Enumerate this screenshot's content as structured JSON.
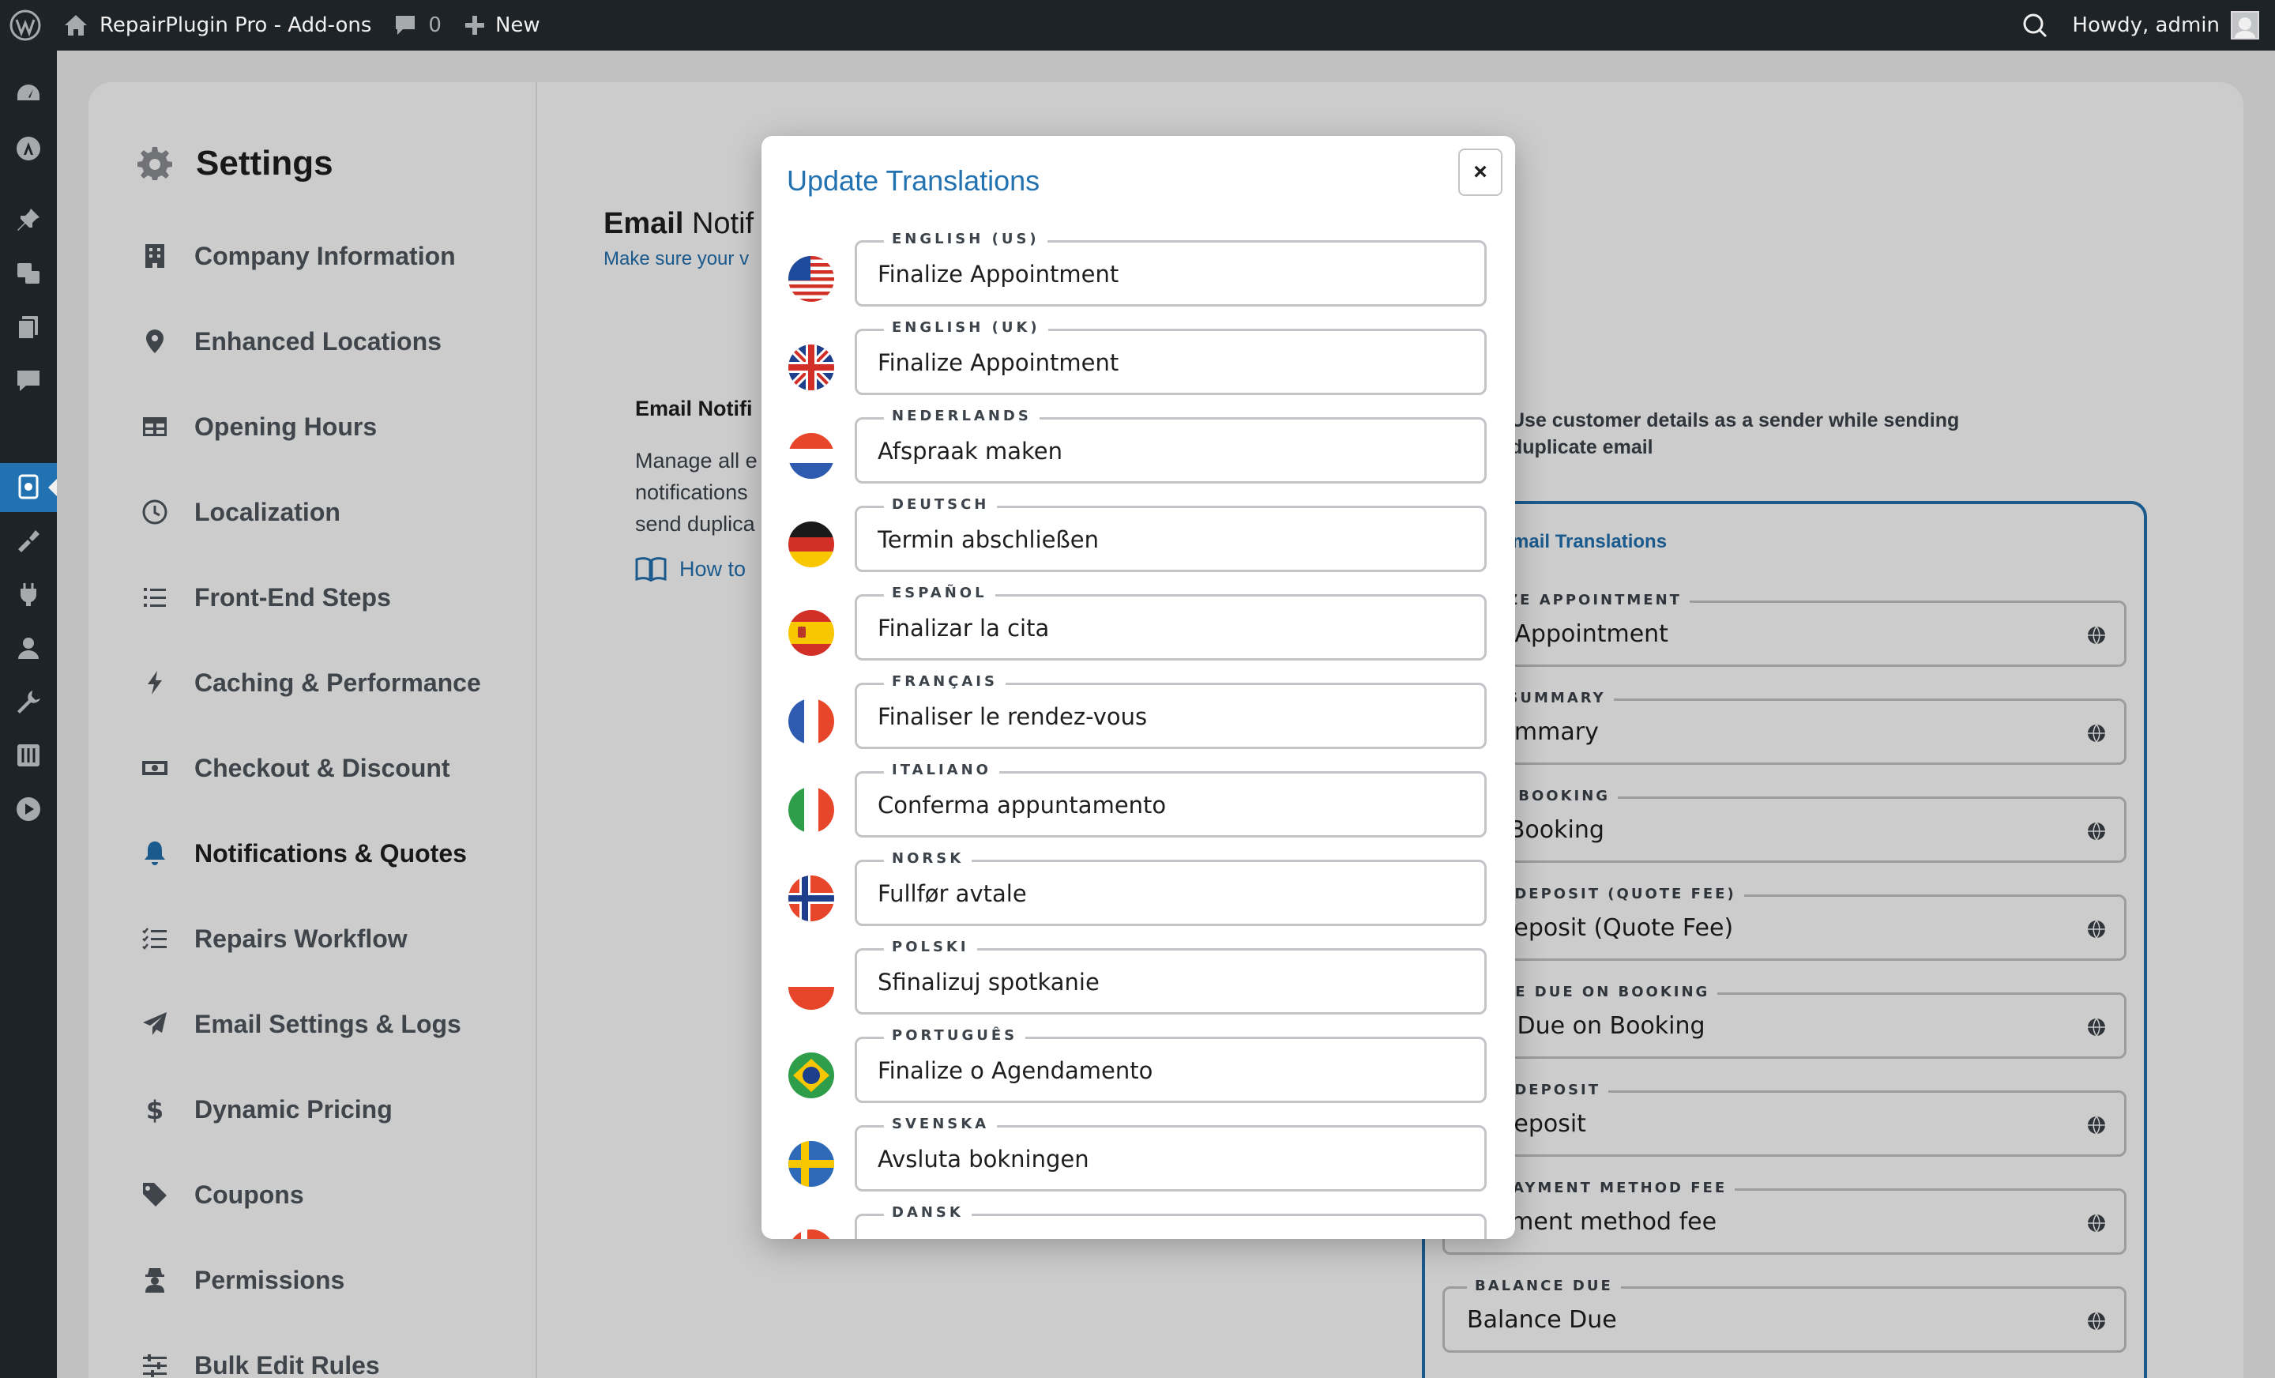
{
  "adminbar": {
    "site_name": "RepairPlugin Pro - Add-ons",
    "comments_count": "0",
    "new_label": "New",
    "howdy": "Howdy, admin"
  },
  "settings": {
    "title": "Settings",
    "nav": [
      {
        "label": "Company Information",
        "icon": "building-icon"
      },
      {
        "label": "Enhanced Locations",
        "icon": "location-pin-icon"
      },
      {
        "label": "Opening Hours",
        "icon": "table-icon"
      },
      {
        "label": "Localization",
        "icon": "clock-icon"
      },
      {
        "label": "Front-End Steps",
        "icon": "list-icon"
      },
      {
        "label": "Caching & Performance",
        "icon": "lightning-icon"
      },
      {
        "label": "Checkout & Discount",
        "icon": "money-icon"
      },
      {
        "label": "Notifications & Quotes",
        "icon": "bell-icon"
      },
      {
        "label": "Repairs Workflow",
        "icon": "checklist-icon"
      },
      {
        "label": "Email Settings & Logs",
        "icon": "paper-plane-icon"
      },
      {
        "label": "Dynamic Pricing",
        "icon": "dollar-icon"
      },
      {
        "label": "Coupons",
        "icon": "tag-icon"
      },
      {
        "label": "Permissions",
        "icon": "user-secret-icon"
      },
      {
        "label": "Bulk Edit Rules",
        "icon": "sliders-icon"
      }
    ]
  },
  "background": {
    "email_heading_bold": "Email",
    "email_heading_rest": "Notif",
    "email_subtext": "Make sure your v",
    "section_label": "Email Notifi",
    "section_desc_1": "Manage all e",
    "section_desc_2": "notifications",
    "section_desc_3": "send duplica",
    "how_to": "How to",
    "sender_option_1": "Use customer details as a sender while sending",
    "sender_option_2": "duplicate email",
    "translations_title": "mail Translations",
    "fields": [
      {
        "label": "ALIZE APPOINTMENT",
        "value": "lize Appointment"
      },
      {
        "label": "ER SUMMARY",
        "value": "r Summary"
      },
      {
        "label": "CEL BOOKING",
        "value": "cel Booking"
      },
      {
        "label": "IAL DEPOSIT (QUOTE FEE)",
        "value": "al Deposit (Quote Fee)"
      },
      {
        "label": "ANCE DUE ON BOOKING",
        "value": "nce Due on Booking"
      },
      {
        "label": "IAL DEPOSIT",
        "value": "al Deposit"
      },
      {
        "label": "L. PAYMENT METHOD FEE",
        "value": "payment method fee"
      },
      {
        "label": "BALANCE DUE",
        "value": "Balance Due"
      }
    ]
  },
  "modal": {
    "title": "Update Translations",
    "close_label": "×",
    "languages": [
      {
        "label": "ENGLISH (US)",
        "value": "Finalize Appointment",
        "flag": "us-flag-icon"
      },
      {
        "label": "ENGLISH (UK)",
        "value": "Finalize Appointment",
        "flag": "uk-flag-icon"
      },
      {
        "label": "NEDERLANDS",
        "value": "Afspraak maken",
        "flag": "nl-flag-icon"
      },
      {
        "label": "DEUTSCH",
        "value": "Termin abschließen",
        "flag": "de-flag-icon"
      },
      {
        "label": "ESPAÑOL",
        "value": "Finalizar la cita",
        "flag": "es-flag-icon"
      },
      {
        "label": "FRANÇAIS",
        "value": "Finaliser le rendez-vous",
        "flag": "fr-flag-icon"
      },
      {
        "label": "ITALIANO",
        "value": "Conferma appuntamento",
        "flag": "it-flag-icon"
      },
      {
        "label": "NORSK",
        "value": "Fullfør avtale",
        "flag": "no-flag-icon"
      },
      {
        "label": "POLSKI",
        "value": "Sfinalizuj spotkanie",
        "flag": "pl-flag-icon"
      },
      {
        "label": "PORTUGUÊS",
        "value": "Finalize o Agendamento",
        "flag": "br-flag-icon"
      },
      {
        "label": "SVENSKA",
        "value": "Avsluta bokningen",
        "flag": "se-flag-icon"
      },
      {
        "label": "DANSK",
        "value": "",
        "flag": "dk-flag-icon"
      }
    ]
  },
  "colors": {
    "accent": "#2271b1",
    "adminbar": "#1d2327"
  }
}
